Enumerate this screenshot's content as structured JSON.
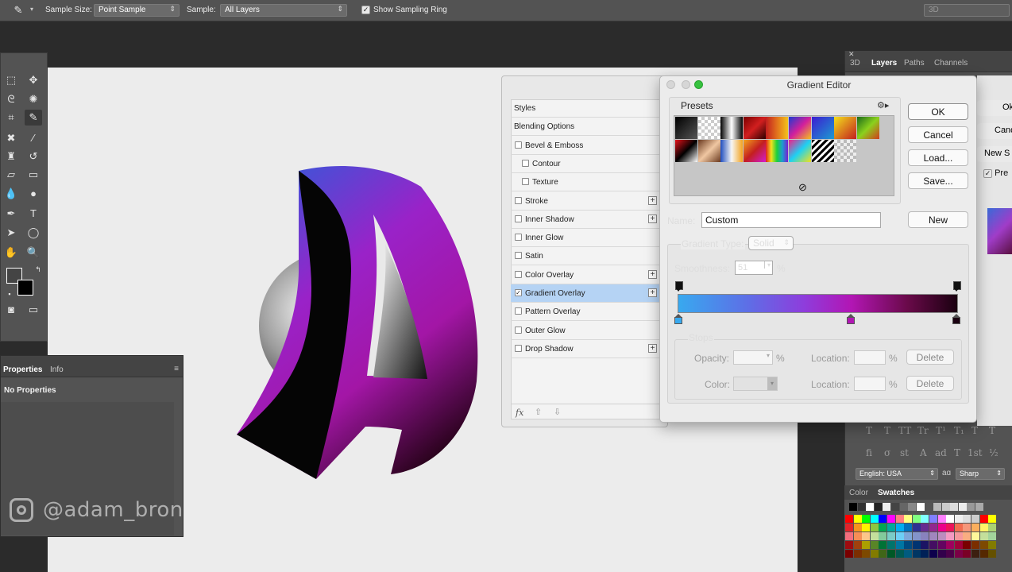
{
  "options_bar": {
    "sample_size_label": "Sample Size:",
    "sample_size_value": "Point Sample",
    "sample_label": "Sample:",
    "sample_value": "All Layers",
    "sampling_ring_label": "Show Sampling Ring",
    "workspace_value": "3D"
  },
  "properties_panel": {
    "tabs": [
      "Properties",
      "Info"
    ],
    "body": "No Properties"
  },
  "watermark": "@adam_bron",
  "right_panel": {
    "tabs": [
      "3D",
      "Layers",
      "Paths",
      "Channels"
    ],
    "ok_partial": "Ok",
    "cancel_partial": "Cand",
    "new_partial": "New S",
    "preview_partial": "Pre",
    "language": "English: USA",
    "aa_icon": "aɑ",
    "antialias": "Sharp",
    "swatch_tabs": [
      "Color",
      "Swatches"
    ],
    "typo_row1": [
      "T",
      "T",
      "TT",
      "Tr",
      "T¹",
      "T₁",
      "T",
      "T"
    ],
    "typo_row2": [
      "fi",
      "σ",
      "st",
      "A",
      "ad",
      "T",
      "1st",
      "½"
    ]
  },
  "layer_style": {
    "items": [
      {
        "label": "Styles",
        "check": false,
        "has_cb": false,
        "plus": false,
        "indent": false
      },
      {
        "label": "Blending Options",
        "check": false,
        "has_cb": false,
        "plus": false,
        "indent": false
      },
      {
        "label": "Bevel & Emboss",
        "check": false,
        "has_cb": true,
        "plus": false,
        "indent": false
      },
      {
        "label": "Contour",
        "check": false,
        "has_cb": true,
        "plus": false,
        "indent": true
      },
      {
        "label": "Texture",
        "check": false,
        "has_cb": true,
        "plus": false,
        "indent": true
      },
      {
        "label": "Stroke",
        "check": false,
        "has_cb": true,
        "plus": true,
        "indent": false
      },
      {
        "label": "Inner Shadow",
        "check": false,
        "has_cb": true,
        "plus": true,
        "indent": false
      },
      {
        "label": "Inner Glow",
        "check": false,
        "has_cb": true,
        "plus": false,
        "indent": false
      },
      {
        "label": "Satin",
        "check": false,
        "has_cb": true,
        "plus": false,
        "indent": false
      },
      {
        "label": "Color Overlay",
        "check": false,
        "has_cb": true,
        "plus": true,
        "indent": false
      },
      {
        "label": "Gradient Overlay",
        "check": true,
        "has_cb": true,
        "plus": true,
        "indent": false,
        "selected": true
      },
      {
        "label": "Pattern Overlay",
        "check": false,
        "has_cb": true,
        "plus": false,
        "indent": false
      },
      {
        "label": "Outer Glow",
        "check": false,
        "has_cb": true,
        "plus": false,
        "indent": false
      },
      {
        "label": "Drop Shadow",
        "check": false,
        "has_cb": true,
        "plus": true,
        "indent": false
      }
    ],
    "footer": "fx"
  },
  "gradient_editor": {
    "title": "Gradient Editor",
    "presets_label": "Presets",
    "ok": "OK",
    "cancel": "Cancel",
    "load": "Load...",
    "save": "Save...",
    "name_label": "Name:",
    "name_value": "Custom",
    "new": "New",
    "gradient_type_label": "Gradient Type:",
    "gradient_type_value": "Solid",
    "smoothness_label": "Smoothness:",
    "smoothness_value": "51",
    "percent": "%",
    "stops_label": "Stops",
    "opacity_label": "Opacity:",
    "color_label": "Color:",
    "location_label": "Location:",
    "delete": "Delete",
    "gradient_colors": [
      "#38a9ef",
      "#8e3ddc",
      "#b216b4",
      "#1a0010"
    ],
    "color_stops": [
      {
        "color": "#38a9ef",
        "location": 0
      },
      {
        "color": "#b216b4",
        "location": 62
      },
      {
        "color": "#1a0010",
        "location": 100
      }
    ]
  },
  "colors": {
    "accent_selected": "#b5d3f4",
    "panel_dark": "#535353",
    "canvas": "#ececec"
  }
}
